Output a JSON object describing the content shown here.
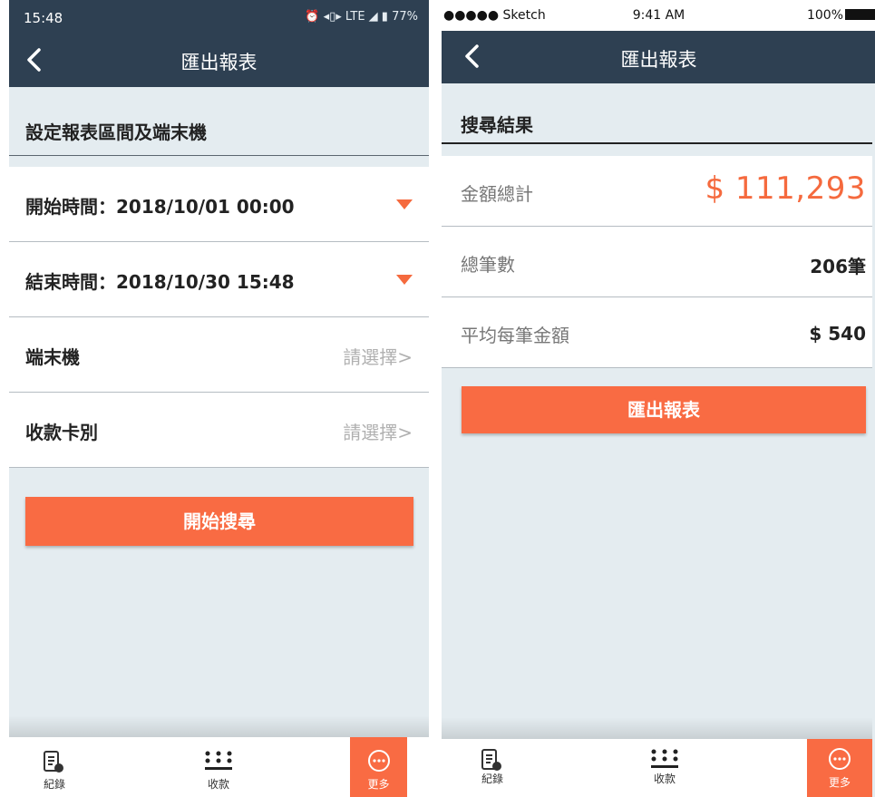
{
  "left_screen": {
    "status_bar": {
      "time": "15:48",
      "indicators": "⏰ ◂▯▸ LTE ◢ ▮ 77%"
    },
    "header": {
      "title": "匯出報表"
    },
    "section_title": "設定報表區間及端末機",
    "rows": [
      {
        "label": "開始時間：",
        "value": "2018/10/01 00:00"
      },
      {
        "label": "結束時間：",
        "value": "2018/10/30 15:48"
      },
      {
        "label": "端末機",
        "placeholder": "請選擇>"
      },
      {
        "label": "收款卡別",
        "placeholder": "請選擇>"
      }
    ],
    "search_button": "開始搜尋"
  },
  "right_screen": {
    "status_bar": {
      "carrier": "●●●●● Sketch",
      "time": "9:41 AM",
      "battery": "100%"
    },
    "header": {
      "title": "匯出報表"
    },
    "section_title": "搜尋結果",
    "results": [
      {
        "label": "金額總計",
        "value": "$ 111,293"
      },
      {
        "label": "總筆數",
        "value": "206筆"
      },
      {
        "label": "平均每筆金額",
        "value": "$ 540"
      }
    ],
    "export_button": "匯出報表"
  },
  "tabbar": {
    "items": [
      {
        "label": "紀錄",
        "icon": "receipt-icon"
      },
      {
        "label": "收款",
        "icon": "keypad-icon"
      },
      {
        "label": "更多",
        "icon": "more-icon"
      }
    ]
  },
  "colors": {
    "accent": "#f96b43",
    "header": "#2e4052",
    "background": "#e4ecf0"
  }
}
